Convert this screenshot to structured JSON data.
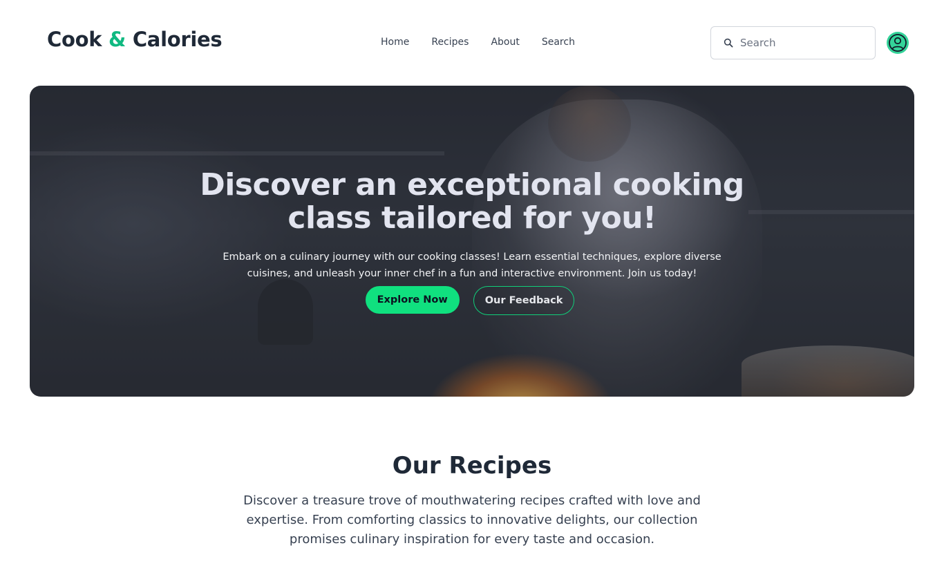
{
  "brand": {
    "name_part1": "Cook",
    "ampersand": "&",
    "name_part2": "Calories",
    "accent_color": "#10b981"
  },
  "nav": {
    "items": [
      {
        "label": "Home"
      },
      {
        "label": "Recipes"
      },
      {
        "label": "About"
      },
      {
        "label": "Search"
      }
    ]
  },
  "search": {
    "placeholder": "Search",
    "value": "",
    "icon": "search-icon"
  },
  "user": {
    "icon": "user-circle-icon",
    "avatar_color": "#34d399"
  },
  "hero": {
    "title": "Discover an exceptional cooking class tailored for you!",
    "description": "Embark on a culinary journey with our cooking classes! Learn essential techniques, explore diverse cuisines, and unleash your inner chef in a fun and interactive environment. Join us today!",
    "primary_button": "Explore Now",
    "secondary_button": "Our Feedback",
    "button_color": "#10e07f"
  },
  "recipes": {
    "title": "Our Recipes",
    "description": "Discover a treasure trove of mouthwatering recipes crafted with love and expertise. From comforting classics to innovative delights, our collection promises culinary inspiration for every taste and occasion."
  }
}
